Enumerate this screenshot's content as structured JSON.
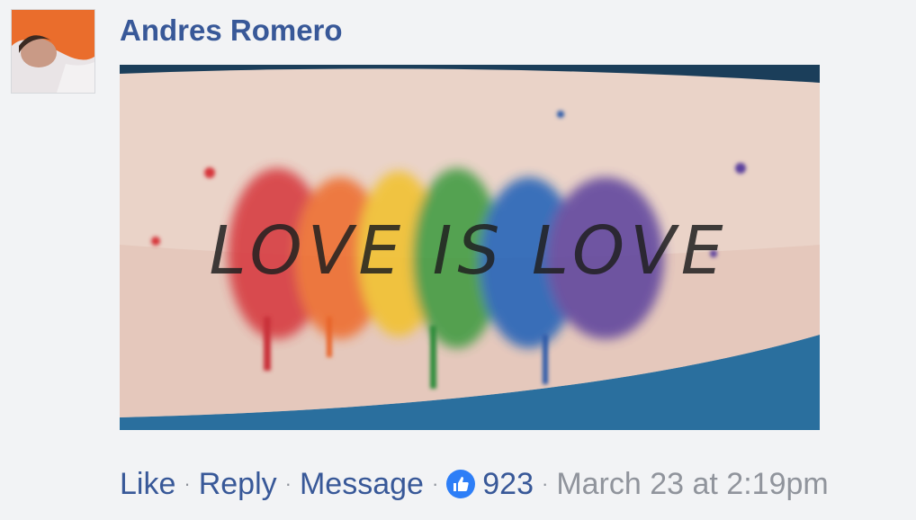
{
  "comment": {
    "author": "Andres Romero",
    "photo_text": "LOVE IS LOVE",
    "actions": {
      "like": "Like",
      "reply": "Reply",
      "message": "Message",
      "separator": "·",
      "reaction_count": "923",
      "timestamp": "March 23 at 2:19pm"
    }
  },
  "colors": {
    "link": "#385898",
    "meta": "#90949c",
    "like_badge": "#2d7ef7",
    "background": "#f2f3f5"
  },
  "icons": {
    "reaction": "thumbs-up-icon"
  }
}
